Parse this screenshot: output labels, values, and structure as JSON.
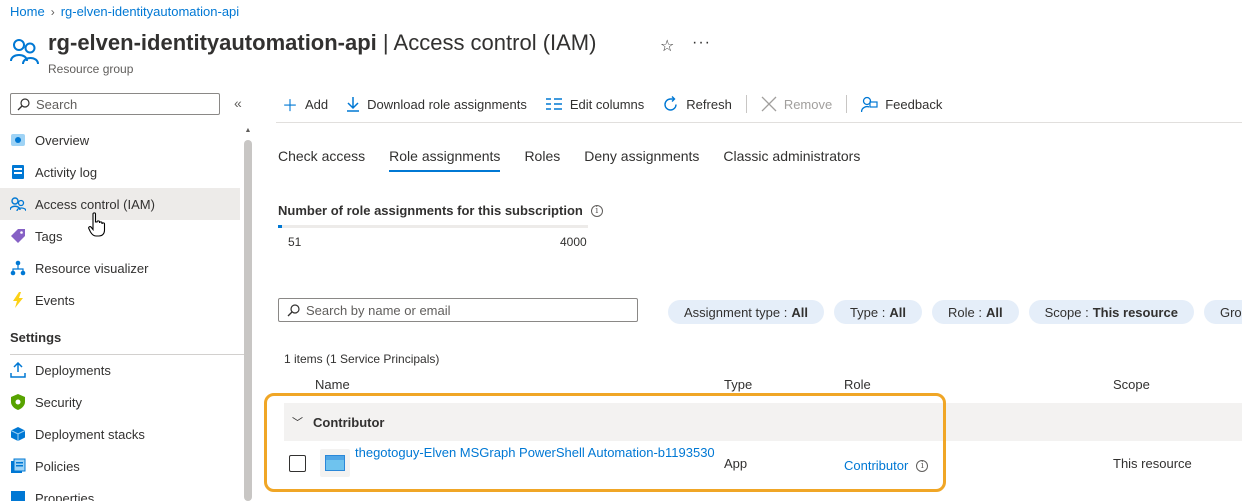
{
  "breadcrumb": {
    "home": "Home",
    "separator": ">",
    "current": "rg-elven-identityautomation-api"
  },
  "header": {
    "resource_name": "rg-elven-identityautomation-api",
    "divider": " | ",
    "page_name": "Access control (IAM)",
    "subtitle": "Resource group",
    "favorite_icon": "star-icon",
    "more_icon": "ellipsis-icon"
  },
  "sidebar": {
    "search_placeholder": "Search",
    "collapse": "«",
    "items": [
      {
        "label": "Overview",
        "icon": "overview-icon"
      },
      {
        "label": "Activity log",
        "icon": "activity-log-icon"
      },
      {
        "label": "Access control (IAM)",
        "icon": "iam-icon",
        "active": true
      },
      {
        "label": "Tags",
        "icon": "tag-icon"
      },
      {
        "label": "Resource visualizer",
        "icon": "visualizer-icon"
      },
      {
        "label": "Events",
        "icon": "lightning-icon"
      }
    ],
    "settings_heading": "Settings",
    "settings_items": [
      {
        "label": "Deployments",
        "icon": "deployments-icon"
      },
      {
        "label": "Security",
        "icon": "shield-icon"
      },
      {
        "label": "Deployment stacks",
        "icon": "stacks-icon"
      },
      {
        "label": "Policies",
        "icon": "policies-icon"
      },
      {
        "label": "Properties",
        "icon": "properties-icon"
      }
    ]
  },
  "toolbar": {
    "add": "Add",
    "download": "Download role assignments",
    "edit_columns": "Edit columns",
    "refresh": "Refresh",
    "remove": "Remove",
    "feedback": "Feedback"
  },
  "tabs": [
    "Check access",
    "Role assignments",
    "Roles",
    "Deny assignments",
    "Classic administrators"
  ],
  "active_tab": "Role assignments",
  "assignment_count": {
    "title": "Number of role assignments for this subscription",
    "current": "51",
    "max": "4000",
    "fill_fraction": 0.0128
  },
  "filter": {
    "search_placeholder": "Search by name or email",
    "pills": [
      {
        "key": "Assignment type :",
        "value": "All"
      },
      {
        "key": "Type :",
        "value": "All"
      },
      {
        "key": "Role :",
        "value": "All"
      },
      {
        "key": "Scope :",
        "value": "This resource"
      },
      {
        "key": "Gro",
        "value": ""
      }
    ]
  },
  "table": {
    "summary": "1 items (1 Service Principals)",
    "columns": {
      "name": "Name",
      "type": "Type",
      "role": "Role",
      "scope": "Scope"
    },
    "group": "Contributor",
    "rows": [
      {
        "name": "thegotoguy-Elven MSGraph PowerShell Automation-b1193530",
        "type": "App",
        "role": "Contributor",
        "scope": "This resource"
      }
    ]
  },
  "colors": {
    "accent": "#0078d4",
    "highlight": "#f0a626",
    "pill_bg": "#e5eef9"
  }
}
